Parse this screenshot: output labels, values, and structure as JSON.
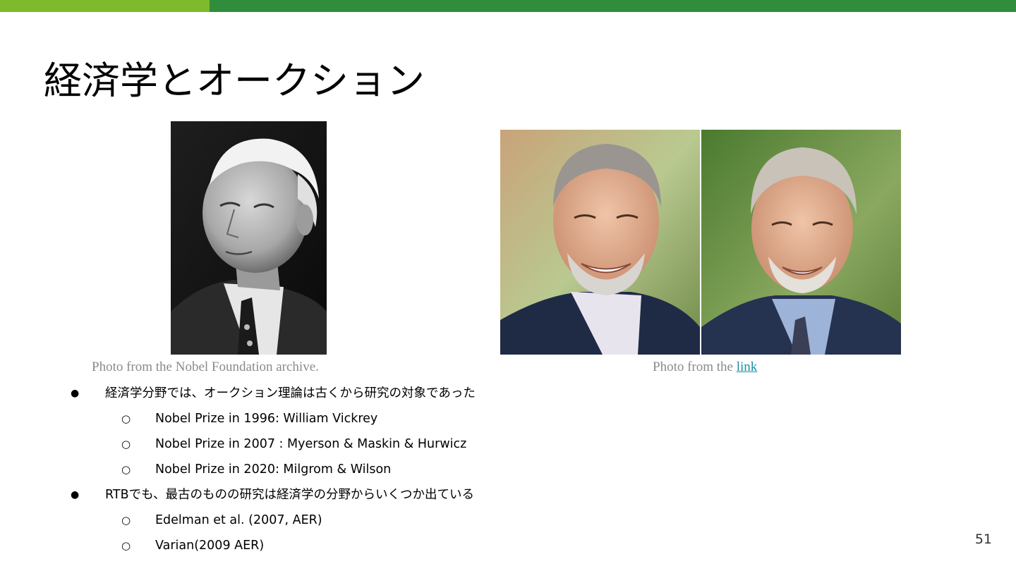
{
  "slide": {
    "title": "経済学とオークション",
    "page_number": "51",
    "colors": {
      "bar_light": "#7dbb2d",
      "bar_dark": "#2f8d3c",
      "link": "#1a8fa0"
    }
  },
  "photos": {
    "left": {
      "icon": "portrait-photo-bw",
      "caption": "Photo from the Nobel Foundation archive."
    },
    "right": {
      "icon": "portrait-photo-color-pair",
      "caption_prefix": "Photo from the ",
      "caption_link": "link"
    }
  },
  "bullets": [
    {
      "level": 1,
      "marker": "●",
      "text": "経済学分野では、オークション理論は古くから研究の対象であった"
    },
    {
      "level": 2,
      "marker": "○",
      "text": "Nobel Prize in 1996: William Vickrey"
    },
    {
      "level": 2,
      "marker": "○",
      "text": "Nobel Prize in 2007 : Myerson & Maskin & Hurwicz"
    },
    {
      "level": 2,
      "marker": "○",
      "text": "Nobel Prize in 2020: Milgrom & Wilson"
    },
    {
      "level": 1,
      "marker": "●",
      "text": "RTBでも、最古のものの研究は経済学の分野からいくつか出ている"
    },
    {
      "level": 2,
      "marker": "○",
      "text": "Edelman et al. (2007, AER)"
    },
    {
      "level": 2,
      "marker": "○",
      "text": "Varian(2009 AER)"
    }
  ]
}
